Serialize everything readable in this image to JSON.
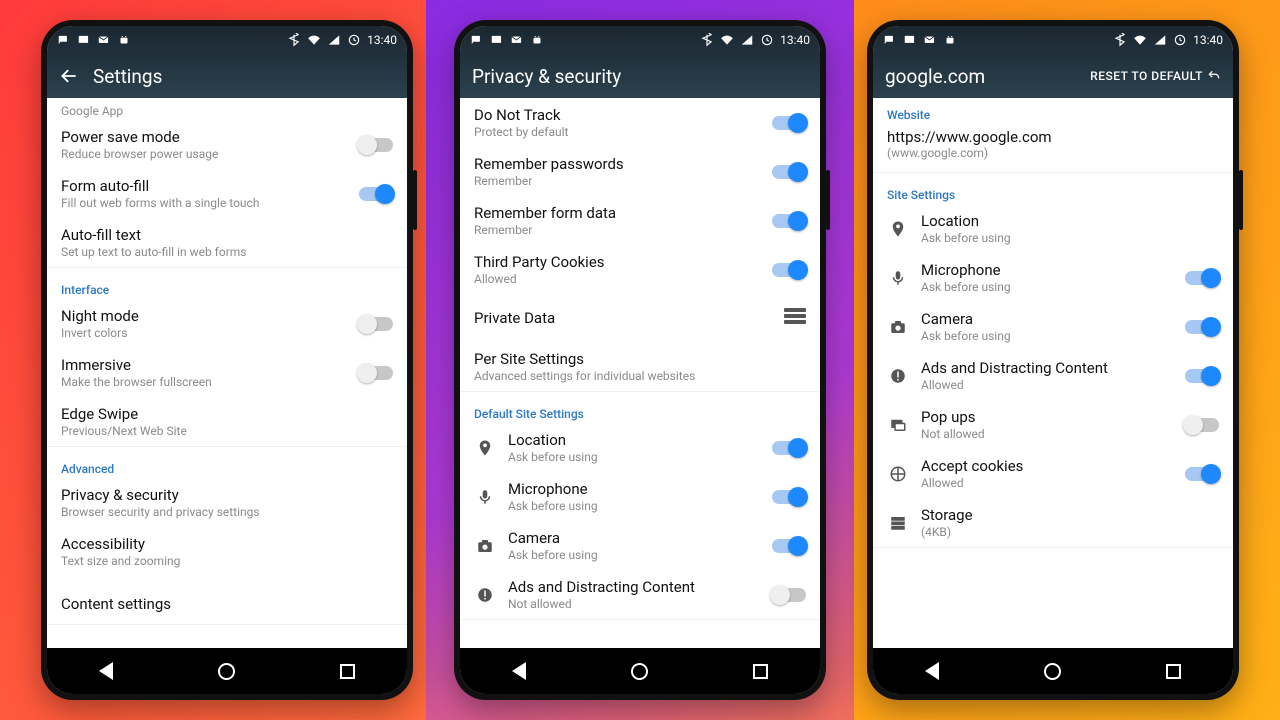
{
  "status": {
    "time": "13:40"
  },
  "phone1": {
    "title": "Settings",
    "group0_sub": "Google App",
    "items_main": [
      {
        "title": "Power save mode",
        "sub": "Reduce browser power usage",
        "on": false
      },
      {
        "title": "Form auto-fill",
        "sub": "Fill out web forms with a single touch",
        "on": true
      },
      {
        "title": "Auto-fill text",
        "sub": "Set up text to auto-fill in web forms",
        "on": null
      }
    ],
    "group_interface_label": "Interface",
    "items_interface": [
      {
        "title": "Night mode",
        "sub": "Invert colors",
        "on": false
      },
      {
        "title": "Immersive",
        "sub": "Make the browser fullscreen",
        "on": false
      },
      {
        "title": "Edge Swipe",
        "sub": "Previous/Next Web Site",
        "on": null
      }
    ],
    "group_advanced_label": "Advanced",
    "items_advanced": [
      {
        "title": "Privacy & security",
        "sub": "Browser security and privacy settings"
      },
      {
        "title": "Accessibility",
        "sub": "Text size and zooming"
      },
      {
        "title": "Content settings",
        "sub": ""
      }
    ]
  },
  "phone2": {
    "title": "Privacy & security",
    "items_top": [
      {
        "title": "Do Not Track",
        "sub": "Protect by default",
        "on": true
      },
      {
        "title": "Remember passwords",
        "sub": "Remember",
        "on": true
      },
      {
        "title": "Remember form data",
        "sub": "Remember",
        "on": true
      },
      {
        "title": "Third Party Cookies",
        "sub": "Allowed",
        "on": true
      }
    ],
    "private_data_label": "Private Data",
    "per_site_title": "Per Site Settings",
    "per_site_sub": "Advanced settings for individual websites",
    "default_label": "Default Site Settings",
    "defaults": [
      {
        "icon": "location",
        "title": "Location",
        "sub": "Ask before using",
        "on": true
      },
      {
        "icon": "mic",
        "title": "Microphone",
        "sub": "Ask before using",
        "on": true
      },
      {
        "icon": "camera",
        "title": "Camera",
        "sub": "Ask before using",
        "on": true
      },
      {
        "icon": "alert",
        "title": "Ads and Distracting Content",
        "sub": "Not allowed",
        "on": false
      }
    ]
  },
  "phone3": {
    "title": "google.com",
    "reset_label": "RESET TO DEFAULT",
    "website_label": "Website",
    "website_url": "https://www.google.com",
    "website_paren": "(www.google.com)",
    "site_settings_label": "Site Settings",
    "site_items": [
      {
        "icon": "location",
        "title": "Location",
        "sub": "Ask before using",
        "on": null
      },
      {
        "icon": "mic",
        "title": "Microphone",
        "sub": "Ask before using",
        "on": true
      },
      {
        "icon": "camera",
        "title": "Camera",
        "sub": "Ask before using",
        "on": true
      },
      {
        "icon": "alert",
        "title": "Ads and Distracting Content",
        "sub": "Allowed",
        "on": true
      },
      {
        "icon": "popup",
        "title": "Pop ups",
        "sub": "Not allowed",
        "on": false
      },
      {
        "icon": "cookie",
        "title": "Accept cookies",
        "sub": "Allowed",
        "on": true
      }
    ],
    "storage_title": "Storage",
    "storage_sub": "(4KB)"
  }
}
